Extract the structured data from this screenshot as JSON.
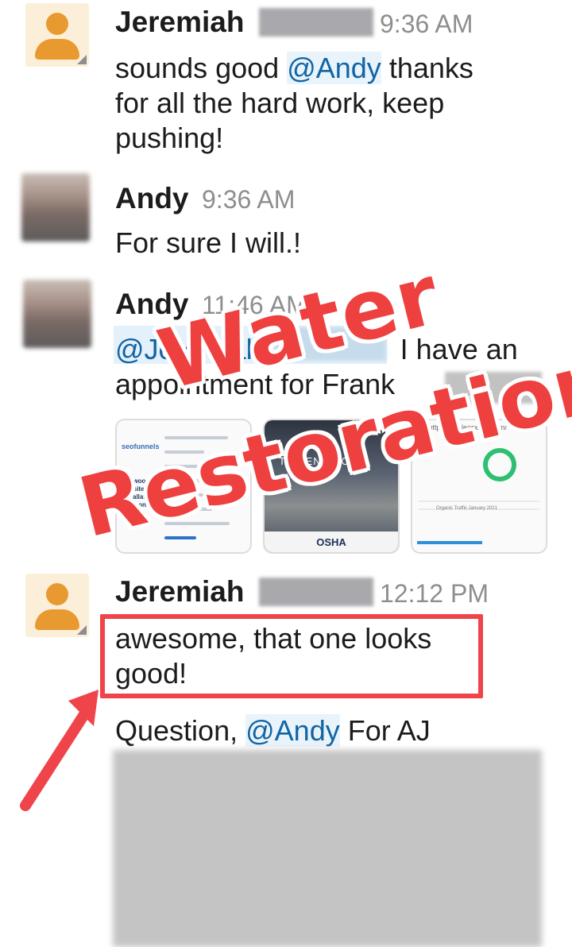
{
  "messages": [
    {
      "author": "Jeremiah",
      "time": "9:36 AM",
      "lines": [
        "sounds good",
        "@Andy",
        "thanks",
        "for all the hard work, keep",
        "pushing!"
      ]
    },
    {
      "author": "Andy",
      "time": "9:36 AM",
      "text": "For sure I will.!"
    },
    {
      "author": "Andy",
      "time": "11:46 AM",
      "mention": "@Jeremiah",
      "line1_rest": "I have an",
      "line2": "appointment for Frank"
    },
    {
      "author": "Jeremiah",
      "time": "12:12 PM",
      "text": [
        "awesome, that one looks",
        "good!"
      ],
      "q_prefix": "Question,",
      "q_mention": "@Andy",
      "q_suffix": "For AJ"
    }
  ],
  "attachments": {
    "thumb1_brand": "seofunnels",
    "thumb1_title": "uplewoodsey Website ...istallation and ...ons",
    "thumb2_heading": "THE ENVIRO...",
    "thumb2_footer": "OSHA",
    "thumb3_url": "w - https://aircleanero...com/",
    "thumb3_caption": "Organic Traffic January 2021"
  },
  "overlay": {
    "line1": "Water",
    "line2": "Restoration"
  },
  "colors": {
    "mention": "#1264a3",
    "annotation": "#ef4449",
    "timestamp": "#8e8e8e",
    "avatar_orange": "#e89a30"
  }
}
